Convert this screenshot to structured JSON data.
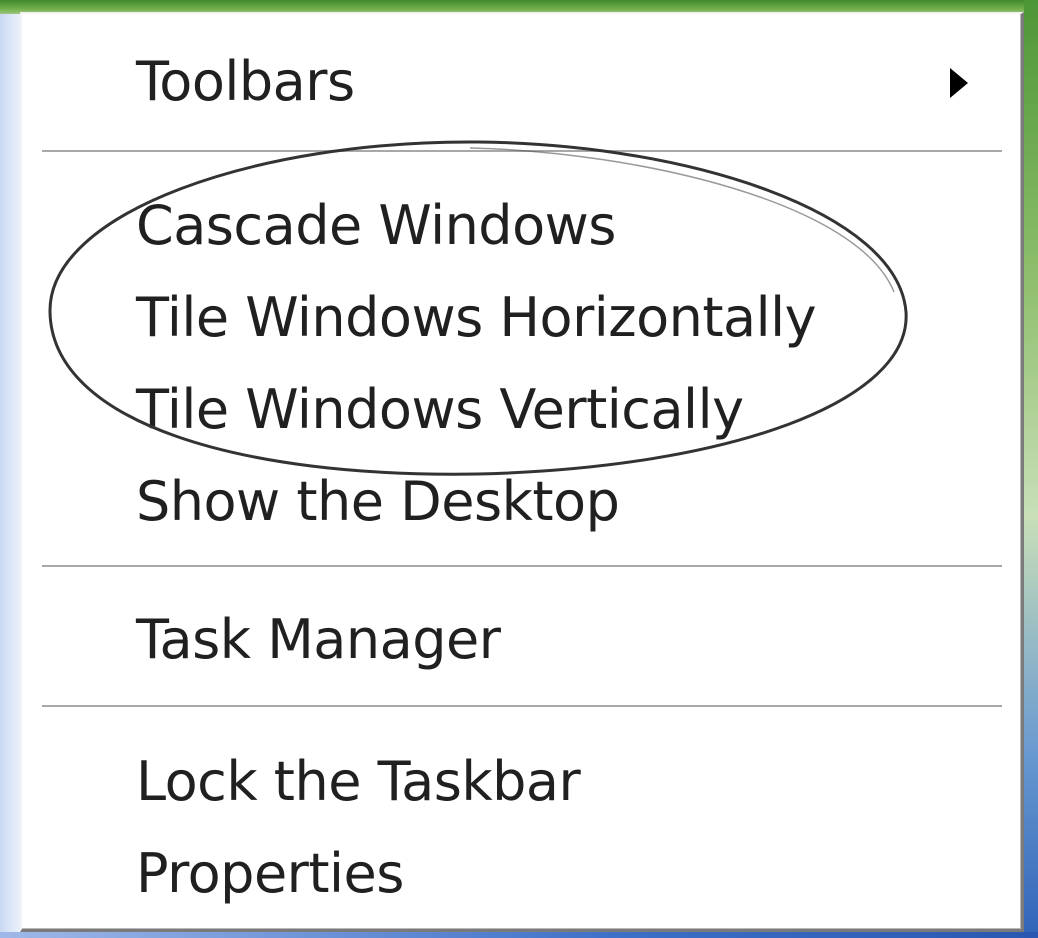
{
  "context_menu": {
    "items": [
      {
        "label": "Toolbars",
        "has_submenu": true
      },
      {
        "label": "Cascade Windows"
      },
      {
        "label": "Tile Windows Horizontally"
      },
      {
        "label": "Tile Windows Vertically"
      },
      {
        "label": "Show the Desktop"
      },
      {
        "label": "Task Manager"
      },
      {
        "label": "Lock the Taskbar"
      },
      {
        "label": "Properties"
      }
    ],
    "separator_after": [
      "Toolbars",
      "Show the Desktop",
      "Task Manager"
    ],
    "highlighted_items": [
      "Cascade Windows",
      "Tile Windows Horizontally",
      "Tile Windows Vertically"
    ],
    "colors": {
      "menu_background": "#ffffff",
      "text": "#202020",
      "separator": "#a8a8a8",
      "annotation_stroke": "#333333",
      "desktop_green": "#4d9636",
      "taskbar_blue": "#2f63b8"
    },
    "icons": {
      "submenu": "triangle-right-icon"
    }
  }
}
